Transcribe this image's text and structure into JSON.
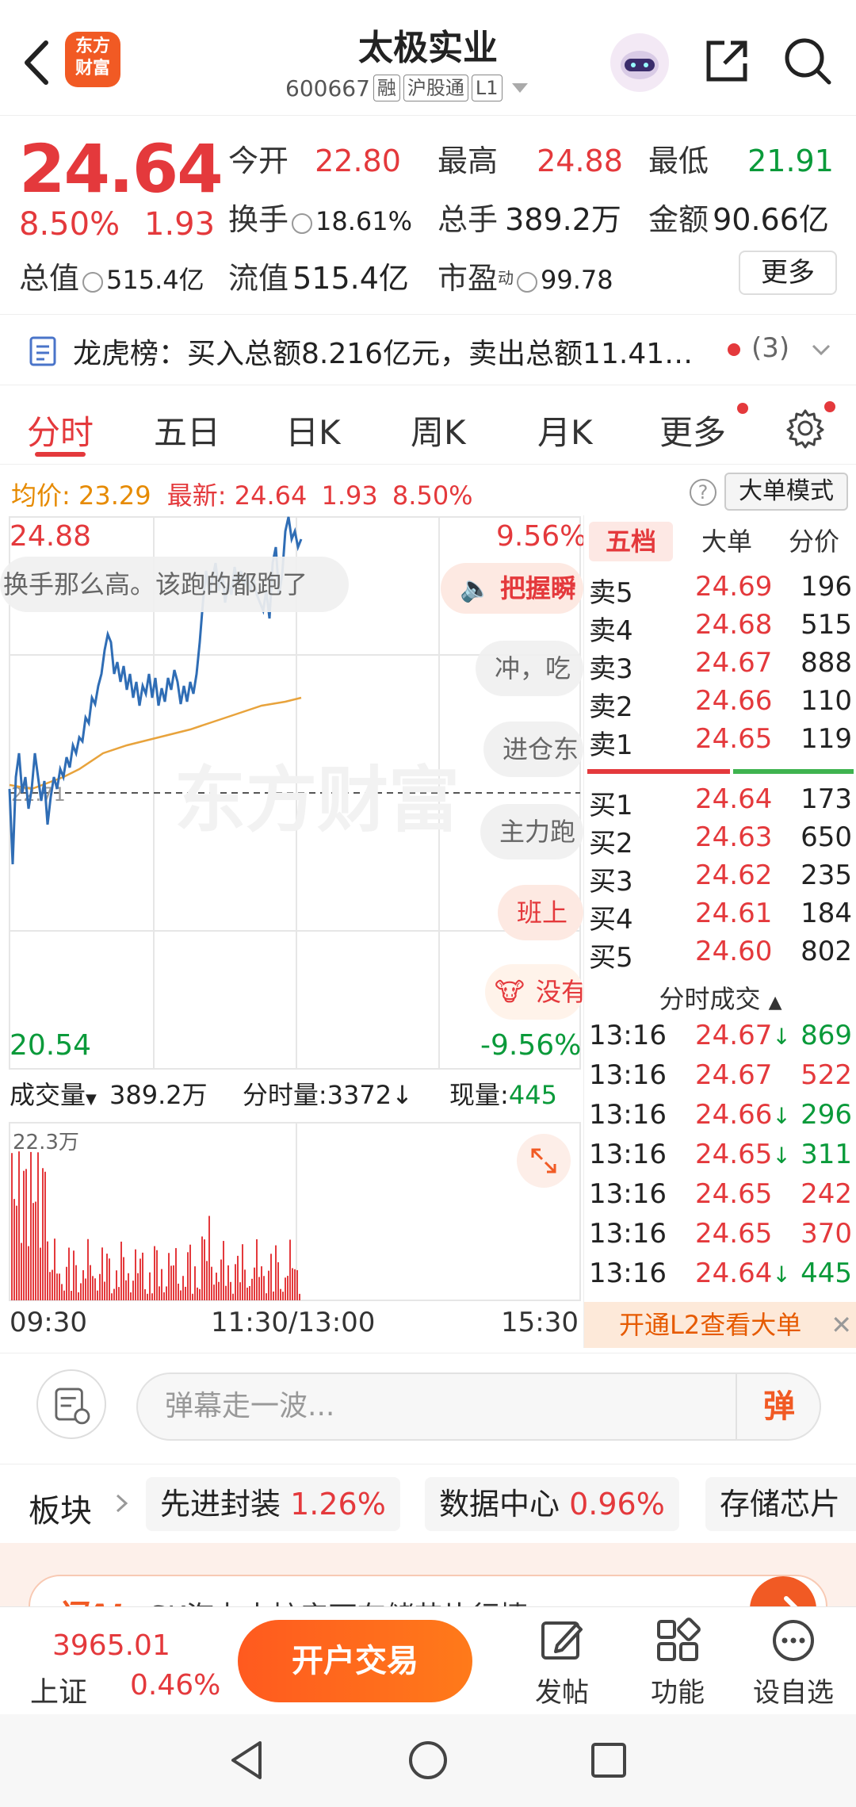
{
  "header": {
    "title": "太极实业",
    "code": "600667",
    "tags": [
      "融",
      "沪股通",
      "L1"
    ],
    "logo_text": "东方财富"
  },
  "quote": {
    "price": "24.64",
    "change_pct": "8.50%",
    "change_abs": "1.93",
    "open_label": "今开",
    "open": "22.80",
    "high_label": "最高",
    "high": "24.88",
    "low_label": "最低",
    "low": "21.91",
    "turnover_label": "换手",
    "turnover": "18.61%",
    "volume_label": "总手",
    "volume": "389.2万",
    "amount_label": "金额",
    "amount": "90.66亿",
    "mktcap_label": "总值",
    "mktcap": "515.4亿",
    "float_label": "流值",
    "float_cap": "515.4亿",
    "pe_label": "市盈",
    "pe_sup": "动",
    "pe": "99.78",
    "more_label": "更多"
  },
  "dragon": {
    "text": "龙虎榜：买入总额8.216亿元，卖出总额11.41…",
    "count": "(3)"
  },
  "tabs": [
    "分时",
    "五日",
    "日K",
    "周K",
    "月K",
    "更多"
  ],
  "info": {
    "avg_label": "均价:",
    "avg": "23.29",
    "latest_label": "最新:",
    "latest": "24.64",
    "latest_chg": "1.93",
    "latest_pct": "8.50%",
    "big_order_mode": "大单模式"
  },
  "chart": {
    "y_top": "24.88",
    "y_bottom": "20.54",
    "pct_top": "9.56%",
    "pct_bottom": "-9.56%",
    "pre_close_label": "22.71",
    "volume_select": "成交量",
    "volume_total": "389.2万",
    "min_volume_label": "分时量:",
    "min_volume": "3372",
    "now_volume_label": "现量:",
    "now_volume": "445",
    "vol_max": "22.3万",
    "time_start": "09:30",
    "time_mid": "11:30/13:00",
    "time_end": "15:30",
    "watermark": "东方财富"
  },
  "bubbles": [
    "换手那么高。该跑的都跑了",
    "把握瞬",
    "冲，吃",
    "进仓东",
    "主力跑",
    "班上",
    "没有"
  ],
  "orderbook": {
    "tabs": [
      "五档",
      "大单",
      "分价"
    ],
    "asks": [
      {
        "label": "卖5",
        "price": "24.69",
        "vol": "196"
      },
      {
        "label": "卖4",
        "price": "24.68",
        "vol": "515"
      },
      {
        "label": "卖3",
        "price": "24.67",
        "vol": "888"
      },
      {
        "label": "卖2",
        "price": "24.66",
        "vol": "110"
      },
      {
        "label": "卖1",
        "price": "24.65",
        "vol": "119"
      }
    ],
    "bids": [
      {
        "label": "买1",
        "price": "24.64",
        "vol": "173"
      },
      {
        "label": "买2",
        "price": "24.63",
        "vol": "650"
      },
      {
        "label": "买3",
        "price": "24.62",
        "vol": "235"
      },
      {
        "label": "买4",
        "price": "24.61",
        "vol": "184"
      },
      {
        "label": "买5",
        "price": "24.60",
        "vol": "802"
      }
    ],
    "trades_title": "分时成交",
    "trades": [
      {
        "time": "13:16",
        "price": "24.67",
        "vol": "869",
        "arrow": "↓"
      },
      {
        "time": "13:16",
        "price": "24.67",
        "vol": "522",
        "arrow": ""
      },
      {
        "time": "13:16",
        "price": "24.66",
        "vol": "296",
        "arrow": "↓"
      },
      {
        "time": "13:16",
        "price": "24.65",
        "vol": "311",
        "arrow": "↓"
      },
      {
        "time": "13:16",
        "price": "24.65",
        "vol": "242",
        "arrow": ""
      },
      {
        "time": "13:16",
        "price": "24.65",
        "vol": "370",
        "arrow": ""
      },
      {
        "time": "13:16",
        "price": "24.64",
        "vol": "445",
        "arrow": "↓"
      }
    ],
    "l2_banner": "开通L2查看大单"
  },
  "comment": {
    "placeholder": "弹幕走一波...",
    "danmu_btn": "弹"
  },
  "sector": {
    "label": "板块",
    "chips": [
      {
        "name": "先进封装",
        "pct": "1.26%"
      },
      {
        "name": "数据中心",
        "pct": "0.96%"
      },
      {
        "name": "存储芯片",
        "pct": ""
      }
    ]
  },
  "ai": {
    "logo": "问AI",
    "text": "SK海力士扩产下存储芯片行情"
  },
  "bottom": {
    "index_value": "3965.01",
    "index_name": "上证",
    "index_change": "0.46%",
    "open_trade": "开户交易",
    "post": "发帖",
    "func": "功能",
    "watch": "设自选"
  },
  "colors": {
    "up": "#e4393c",
    "down": "#0a9a3a",
    "avg_line": "#e8a33c",
    "price_line": "#2f6db5",
    "accent": "#f15a24"
  }
}
